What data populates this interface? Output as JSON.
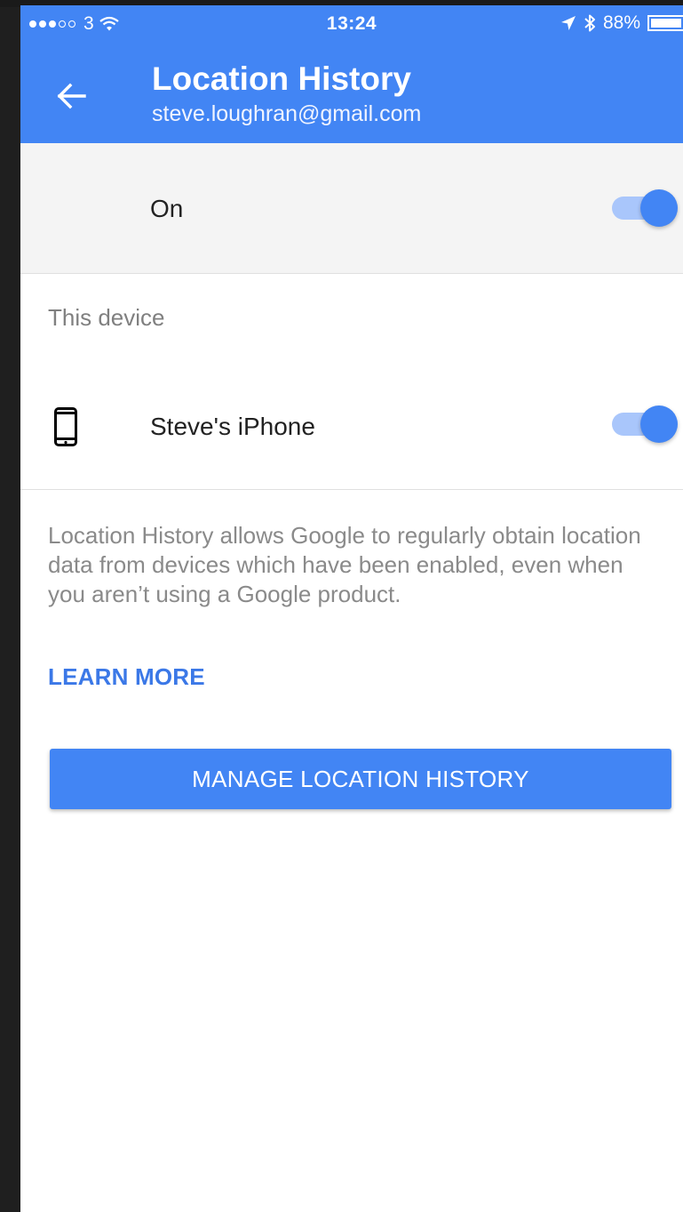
{
  "status_bar": {
    "carrier": "3",
    "time": "13:24",
    "battery": "88%"
  },
  "header": {
    "title": "Location History",
    "account": "steve.loughran@gmail.com"
  },
  "master_toggle": {
    "label": "On",
    "enabled": true
  },
  "section": {
    "title": "This device"
  },
  "device": {
    "name": "Steve's iPhone",
    "enabled": true
  },
  "description": "Location History allows Google to regularly obtain location data from devices which have been enabled, even when you aren’t using a Google product.",
  "learn_more": "LEARN MORE",
  "manage_button": "MANAGE LOCATION HISTORY",
  "colors": {
    "primary": "#4285f4",
    "switch_track": "#a9c6fb",
    "link": "#3b78e7",
    "secondary_text": "#8a8a8a"
  }
}
